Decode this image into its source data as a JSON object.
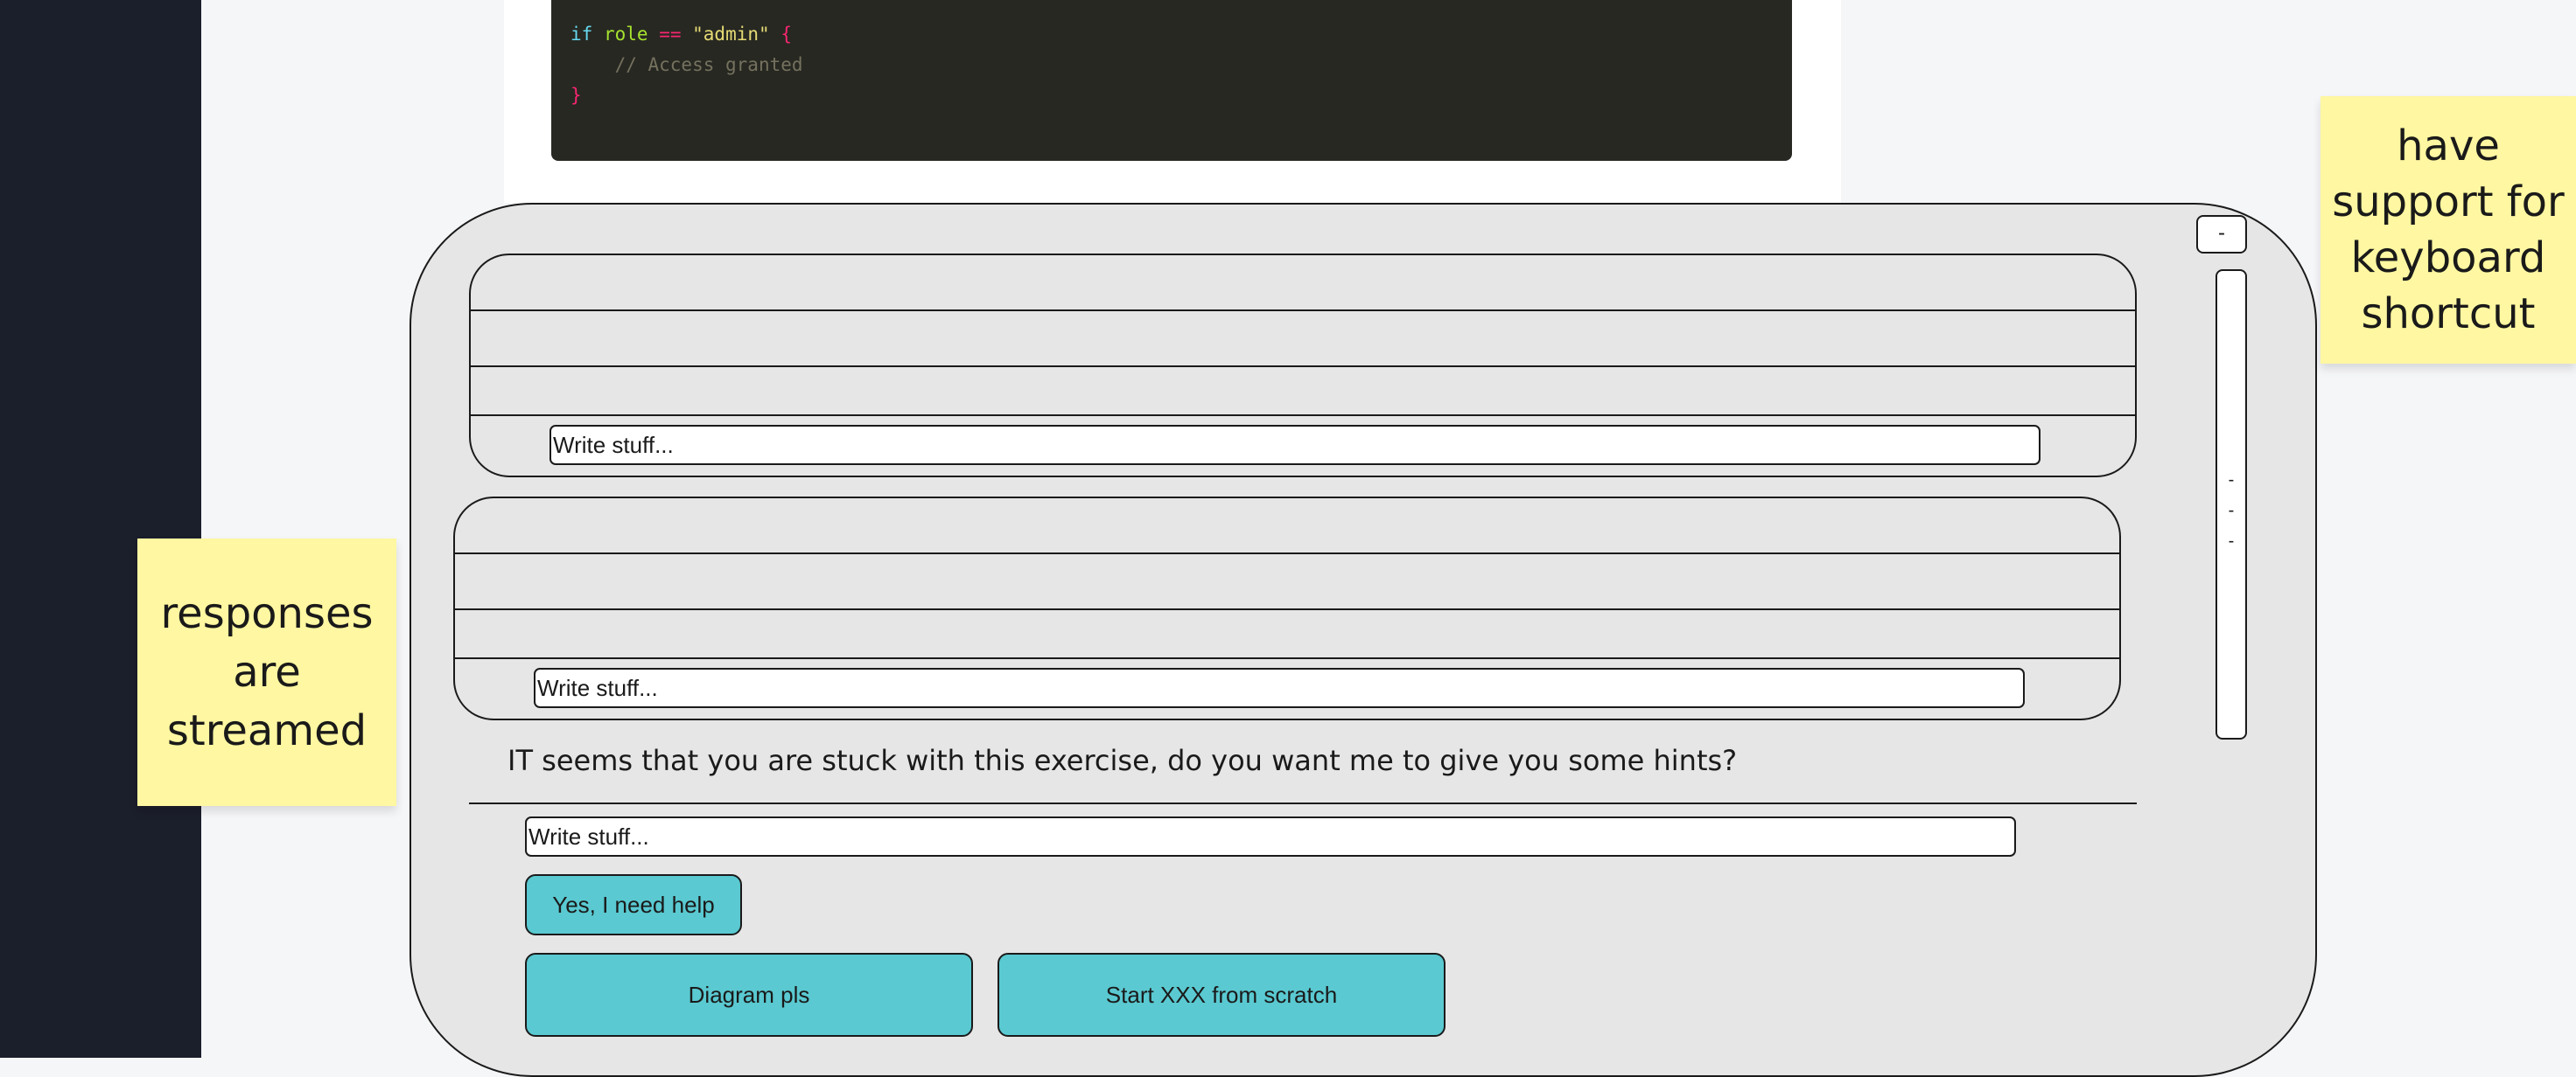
{
  "code": {
    "line1": {
      "keyword": "if",
      "var": "role",
      "op": "==",
      "str": "\"admin\"",
      "brace": "{"
    },
    "line2": {
      "comment": "// Access granted"
    },
    "line3": {
      "brace": "}"
    }
  },
  "chat": {
    "collapse_label": "-",
    "scroll_grip": "-\n-\n-",
    "placeholders": {
      "first": "Write stuff...",
      "second": "Write stuff...",
      "third": "Write stuff..."
    },
    "question": "IT seems that you are stuck with this exercise, do you want me to give you some hints?",
    "buttons": {
      "need_help": "Yes, I need help",
      "diagram": "Diagram pls",
      "start_scratch": "Start XXX from scratch"
    }
  },
  "stickies": {
    "left": "responses are streamed",
    "right": "have support for keyboard shortcut"
  },
  "colors": {
    "sidebar": "#1b1e2b",
    "panel": "#e6e6e6",
    "button": "#5ac9d1",
    "sticky": "#fff7a1",
    "code_bg": "#272822"
  }
}
